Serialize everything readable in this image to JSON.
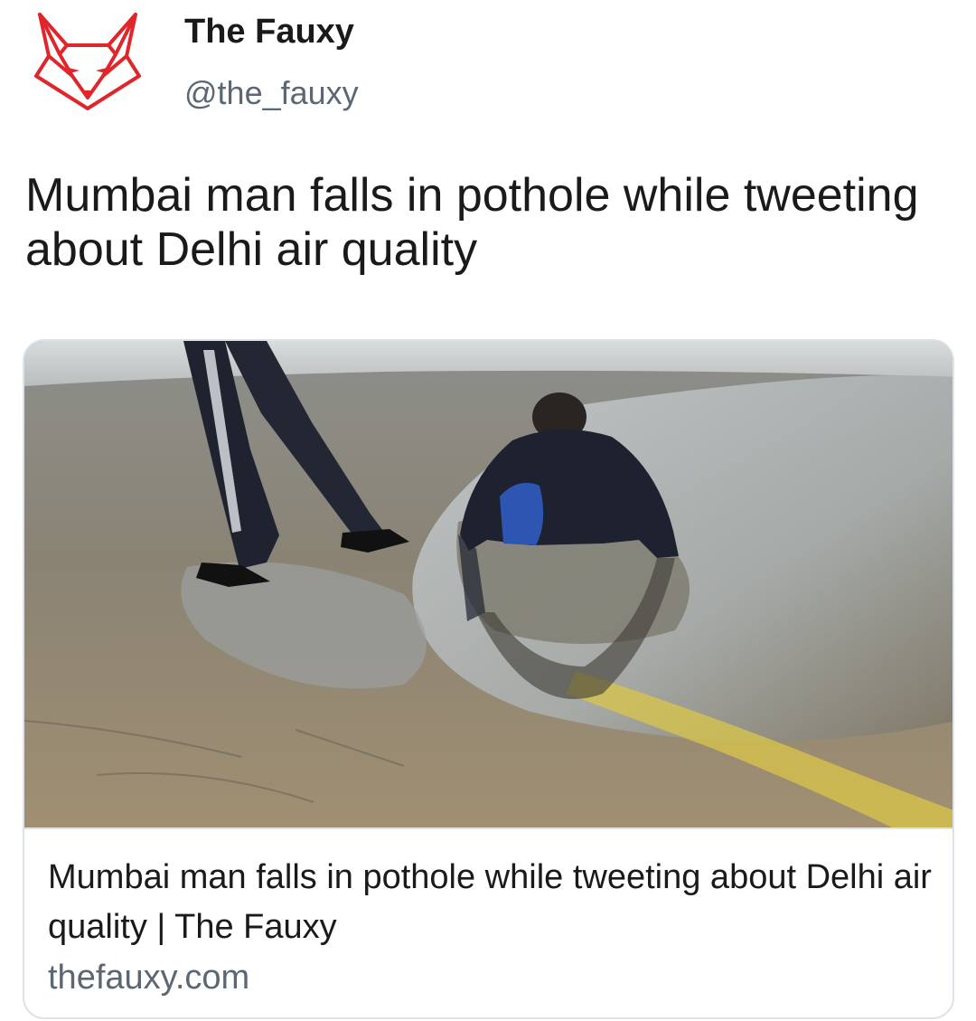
{
  "author": {
    "display_name": "The Fauxy",
    "handle": "@the_fauxy",
    "avatar_icon": "fox-logo-icon",
    "brand_color": "#e0262a"
  },
  "tweet": {
    "text": "Mumbai man falls in pothole while tweeting about Delhi air quality"
  },
  "link_card": {
    "title": "Mumbai man falls in pothole while tweeting about Delhi air quality | The Fauxy",
    "domain": "thefauxy.com",
    "image_icon": "pothole-photo"
  }
}
